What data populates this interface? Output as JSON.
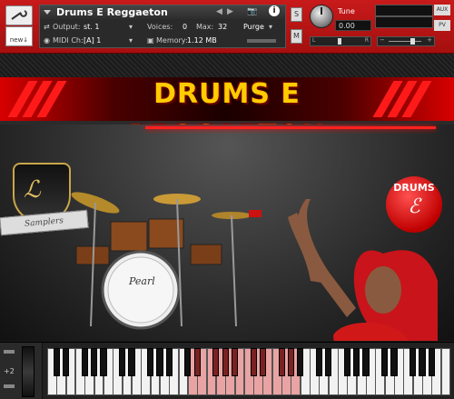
{
  "header": {
    "new_label": "new↓",
    "instrument_name": "Drums E Reggaeton",
    "output_label": "Output:",
    "output_value": "st. 1",
    "voices_label": "Voices:",
    "voices_value": "0",
    "max_label": "Max:",
    "max_value": "32",
    "purge_label": "Purge",
    "midi_label": "MIDI Ch:",
    "midi_value": "[A] 1",
    "memory_label": "Memory:",
    "memory_value": "1.12 MB",
    "solo_label": "S",
    "mute_label": "M",
    "tune_label": "Tune",
    "tune_value": "0.00",
    "aux_label": "AUX",
    "pv_label": "PV",
    "pan_left": "L",
    "pan_right": "R",
    "vol_minus": "−",
    "vol_plus": "+"
  },
  "banner": {
    "title": "DRUMS E REGGAETON"
  },
  "logo": {
    "ribbon_text": "Samplers"
  },
  "badge": {
    "text": "DRUMS",
    "glyph": "ℰ"
  },
  "keyboard": {
    "octave_label": "+2",
    "white_key_count": 43,
    "range_start_key": 15,
    "range_end_key": 26
  },
  "colors": {
    "accent_red": "#c81a1a",
    "title_gold": "#ffcc00",
    "key_range": "#e9a3a3"
  }
}
